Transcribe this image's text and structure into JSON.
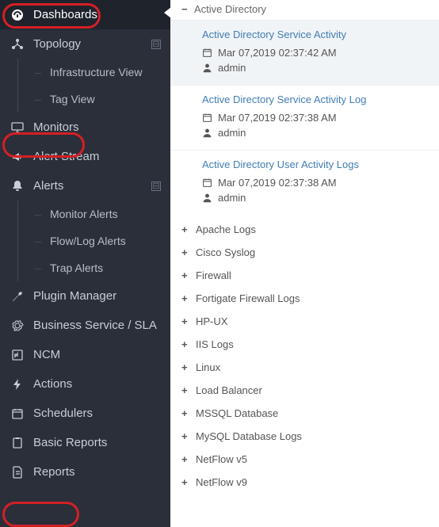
{
  "sidebar": {
    "dashboards": "Dashboards",
    "topology": "Topology",
    "topology_sub": [
      "Infrastructure View",
      "Tag View"
    ],
    "monitors": "Monitors",
    "alert_stream": "Alert Stream",
    "alerts": "Alerts",
    "alerts_sub": [
      "Monitor Alerts",
      "Flow/Log Alerts",
      "Trap Alerts"
    ],
    "plugin_manager": "Plugin Manager",
    "business_service": "Business Service / SLA",
    "ncm": "NCM",
    "actions": "Actions",
    "schedulers": "Schedulers",
    "basic_reports": "Basic Reports",
    "reports": "Reports",
    "expand_sym": "⊟"
  },
  "content": {
    "active_group": "Active Directory",
    "cards": [
      {
        "title": "Active Directory Service Activity",
        "date": "Mar 07,2019 02:37:42 AM",
        "user": "admin",
        "selected": true
      },
      {
        "title": "Active Directory Service Activity Log",
        "date": "Mar 07,2019 02:37:38 AM",
        "user": "admin",
        "selected": false
      },
      {
        "title": "Active Directory User Activity Logs",
        "date": "Mar 07,2019 02:37:38 AM",
        "user": "admin",
        "selected": false
      }
    ],
    "categories": [
      "Apache Logs",
      "Cisco Syslog",
      "Firewall",
      "Fortigate Firewall Logs",
      "HP-UX",
      "IIS Logs",
      "Linux",
      "Load Balancer",
      "MSSQL Database",
      "MySQL Database Logs",
      "NetFlow v5",
      "NetFlow v9"
    ]
  }
}
